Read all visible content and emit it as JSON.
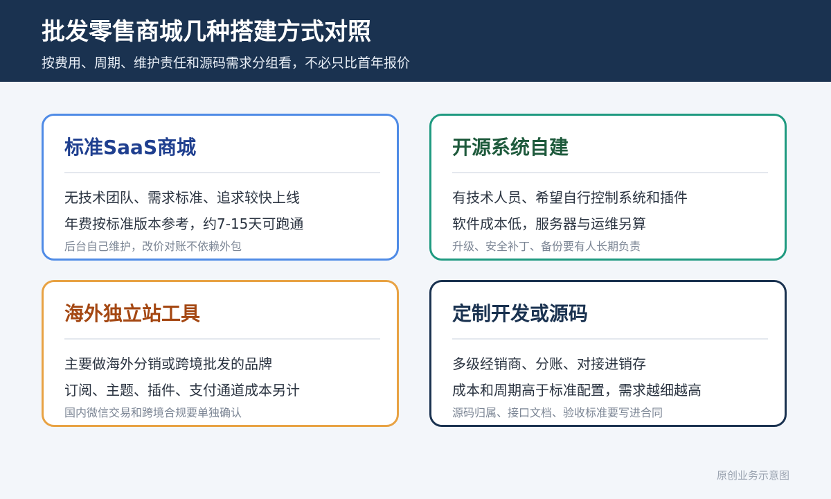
{
  "header": {
    "title": "批发零售商城几种搭建方式对照",
    "subtitle": "按费用、周期、维护责任和源码需求分组看，不必只比首年报价"
  },
  "cards": [
    {
      "title": "标准SaaS商城",
      "lines": [
        "无技术团队、需求标准、追求较快上线",
        "年费按标准版本参考，约7-15天可跑通"
      ],
      "note": "后台自己维护，改价对账不依赖外包",
      "accent": "#4f8be6"
    },
    {
      "title": "开源系统自建",
      "lines": [
        "有技术人员、希望自行控制系统和插件",
        "软件成本低，服务器与运维另算"
      ],
      "note": "升级、安全补丁、备份要有人长期负责",
      "accent": "#1f9a80"
    },
    {
      "title": "海外独立站工具",
      "lines": [
        "主要做海外分销或跨境批发的品牌",
        "订阅、主题、插件、支付通道成本另计"
      ],
      "note": "国内微信交易和跨境合规要单独确认",
      "accent": "#e8a243"
    },
    {
      "title": "定制开发或源码",
      "lines": [
        "多级经销商、分账、对接进销存",
        "成本和周期高于标准配置，需求越细越高"
      ],
      "note": "源码归属、接口文档、验收标准要写进合同",
      "accent": "#1a3250"
    }
  ],
  "footer": {
    "text": "原创业务示意图"
  }
}
